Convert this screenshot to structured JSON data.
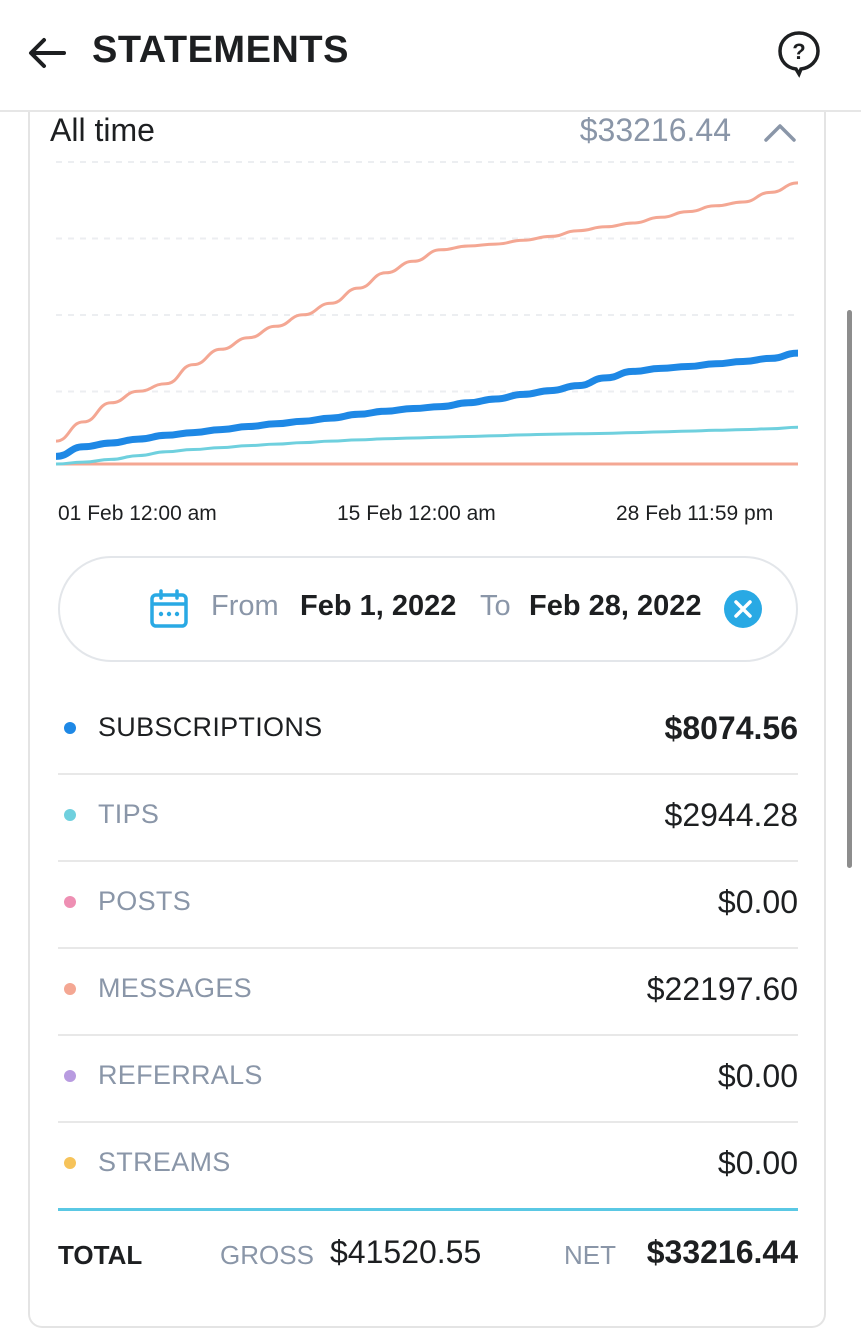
{
  "header": {
    "title": "STATEMENTS",
    "back_icon": "arrow-left-icon",
    "help_icon": "help-circle-icon"
  },
  "summary": {
    "period": "All time",
    "total": "$33216.44",
    "toggle_icon": "chevron-up-icon"
  },
  "chart_data": {
    "type": "line",
    "x_ticks": [
      "01 Feb 12:00 am",
      "15 Feb 12:00 am",
      "28 Feb 11:59 pm"
    ],
    "grid": "dashed-horizontal",
    "series": [
      {
        "key": "messages",
        "color": "#f4a793",
        "values": [
          0.6,
          1.1,
          1.6,
          1.9,
          2.1,
          2.6,
          3.0,
          3.3,
          3.6,
          3.9,
          4.2,
          4.6,
          5.0,
          5.3,
          5.6,
          5.7,
          5.75,
          5.85,
          5.95,
          6.1,
          6.2,
          6.3,
          6.45,
          6.6,
          6.75,
          6.85,
          7.1,
          7.35
        ]
      },
      {
        "key": "subscriptions",
        "color": "#1e88e5",
        "values": [
          0.2,
          0.45,
          0.55,
          0.65,
          0.75,
          0.82,
          0.9,
          0.98,
          1.05,
          1.12,
          1.2,
          1.3,
          1.38,
          1.45,
          1.5,
          1.6,
          1.7,
          1.82,
          1.92,
          2.05,
          2.25,
          2.42,
          2.5,
          2.55,
          2.62,
          2.68,
          2.76,
          2.9
        ]
      },
      {
        "key": "tips",
        "color": "#6fd0de",
        "values": [
          0.0,
          0.05,
          0.12,
          0.22,
          0.32,
          0.38,
          0.43,
          0.48,
          0.52,
          0.56,
          0.6,
          0.63,
          0.66,
          0.68,
          0.7,
          0.72,
          0.74,
          0.76,
          0.78,
          0.79,
          0.8,
          0.82,
          0.84,
          0.86,
          0.88,
          0.9,
          0.92,
          0.96
        ]
      },
      {
        "key": "posts",
        "color": "#f4a793",
        "values": [
          0,
          0,
          0,
          0,
          0,
          0,
          0,
          0,
          0,
          0,
          0,
          0,
          0,
          0,
          0,
          0,
          0,
          0,
          0,
          0,
          0,
          0,
          0,
          0,
          0,
          0,
          0,
          0
        ]
      }
    ],
    "ylim": [
      0,
      8
    ]
  },
  "date_range": {
    "calendar_icon": "calendar-icon",
    "from_label": "From",
    "from_value": "Feb 1, 2022",
    "to_label": "To",
    "to_value": "Feb 28, 2022",
    "clear_icon": "close-circle-icon"
  },
  "categories": [
    {
      "label": "SUBSCRIPTIONS",
      "amount": "$8074.56",
      "color": "#1e88e5",
      "active": true
    },
    {
      "label": "TIPS",
      "amount": "$2944.28",
      "color": "#6fd0de",
      "active": false
    },
    {
      "label": "POSTS",
      "amount": "$0.00",
      "color": "#ee8fb3",
      "active": false
    },
    {
      "label": "MESSAGES",
      "amount": "$22197.60",
      "color": "#f4a793",
      "active": false
    },
    {
      "label": "REFERRALS",
      "amount": "$0.00",
      "color": "#b89be0",
      "active": false
    },
    {
      "label": "STREAMS",
      "amount": "$0.00",
      "color": "#f6c35a",
      "active": false
    }
  ],
  "totals": {
    "label": "TOTAL",
    "gross_label": "GROSS",
    "gross_value": "$41520.55",
    "net_label": "NET",
    "net_value": "$33216.44"
  }
}
